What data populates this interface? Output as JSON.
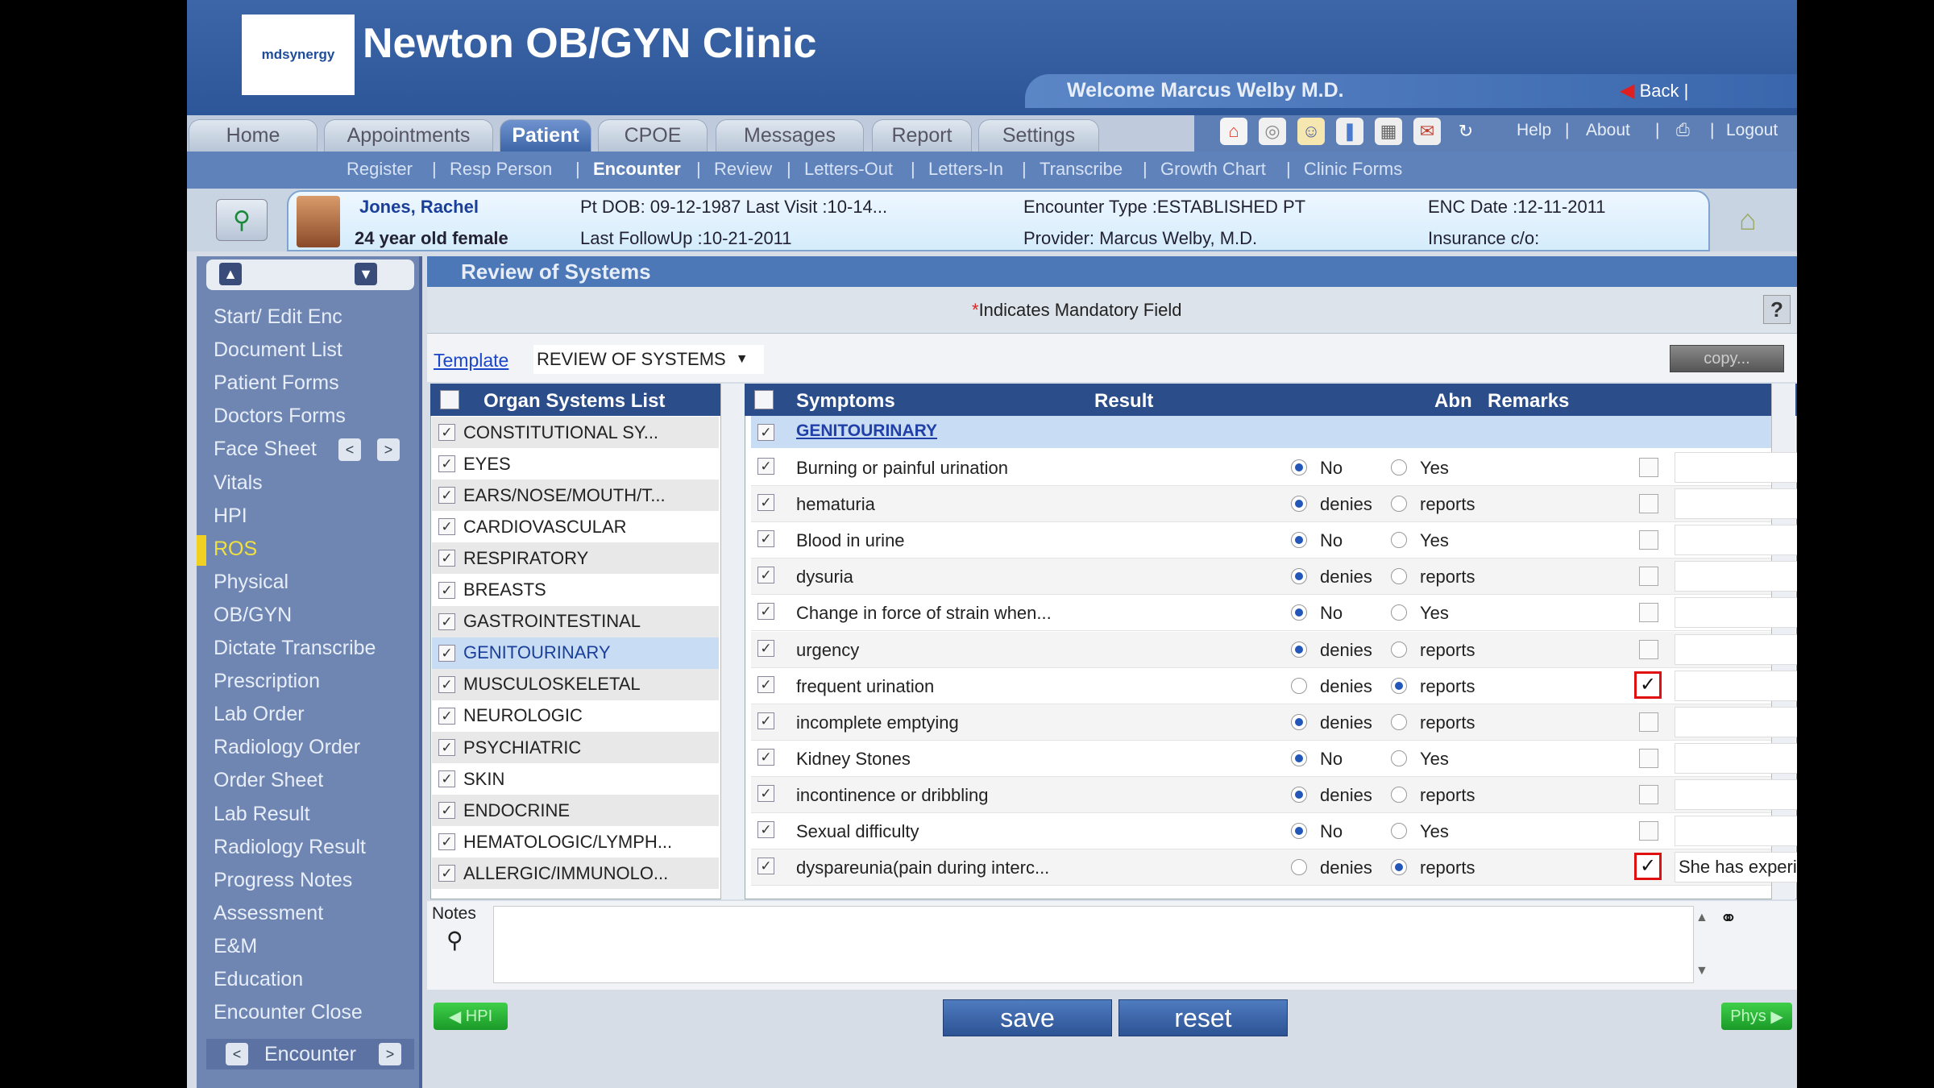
{
  "header": {
    "logo_text": "mdsynergy",
    "clinic_name": "Newton OB/GYN Clinic",
    "welcome": "Welcome Marcus Welby M.D.",
    "back_label": "Back"
  },
  "tabs": [
    "Home",
    "Appointments",
    "Patient",
    "CPOE",
    "Messages",
    "Report",
    "Settings"
  ],
  "active_tab": "Patient",
  "top_links": {
    "help": "Help",
    "about": "About",
    "logout": "Logout"
  },
  "toolbar_icons": [
    "alert-icon",
    "lab-icon",
    "user-icon",
    "vitals-icon",
    "chart-icon",
    "mail-icon",
    "refresh-icon"
  ],
  "subnav": [
    "Register",
    "Resp Person",
    "Encounter",
    "Review",
    "Letters-Out",
    "Letters-In",
    "Transcribe",
    "Growth Chart",
    "Clinic Forms"
  ],
  "patient": {
    "name": "Jones, Rachel",
    "age_sex": "24 year old female",
    "dob_last_visit": "Pt DOB: 09-12-1987 Last Visit :10-14...",
    "last_followup": "Last FollowUp :10-21-2011",
    "encounter_type": "Encounter Type :ESTABLISHED PT",
    "provider": "Provider: Marcus Welby, M.D.",
    "enc_date": "ENC Date :12-11-2011",
    "insurance": "Insurance c/o:"
  },
  "sidebar": {
    "items": [
      "Start/ Edit Enc",
      "Document List",
      "Patient Forms",
      "Doctors Forms",
      "Face Sheet",
      "Vitals",
      "HPI",
      "ROS",
      "Physical",
      "OB/GYN",
      "Dictate Transcribe",
      "Prescription",
      "Lab Order",
      "Radiology Order",
      "Order Sheet",
      "Lab Result",
      "Radiology Result",
      "Progress Notes",
      "Assessment",
      "E&M",
      "Education",
      "Encounter Close"
    ],
    "active": "ROS",
    "bottom_label": "Encounter"
  },
  "page_title": "Review of Systems",
  "mandatory_note": "Indicates Mandatory Field",
  "mandatory_mark": "*",
  "help_label": "?",
  "template": {
    "link": "Template",
    "selected": "REVIEW OF SYSTEMS",
    "copy_label": "copy..."
  },
  "organ_list": {
    "header": "Organ Systems List",
    "items": [
      "CONSTITUTIONAL SY...",
      "EYES",
      "EARS/NOSE/MOUTH/T...",
      "CARDIOVASCULAR",
      "RESPIRATORY",
      "BREASTS",
      "GASTROINTESTINAL",
      "GENITOURINARY",
      "MUSCULOSKELETAL",
      "NEUROLOGIC",
      "PSYCHIATRIC",
      "SKIN",
      "ENDOCRINE",
      "HEMATOLOGIC/LYMPH...",
      "ALLERGIC/IMMUNOLO..."
    ],
    "selected": "GENITOURINARY"
  },
  "symptoms_table": {
    "headers": {
      "symptoms": "Symptoms",
      "result": "Result",
      "abn": "Abn",
      "remarks": "Remarks"
    },
    "group": "GENITOURINARY",
    "rows": [
      {
        "symptom": "Burning or painful urination",
        "opt1": "No",
        "opt2": "Yes",
        "selected": 1,
        "abn": false,
        "remark": ""
      },
      {
        "symptom": "hematuria",
        "opt1": "denies",
        "opt2": "reports",
        "selected": 1,
        "abn": false,
        "remark": ""
      },
      {
        "symptom": "Blood in urine",
        "opt1": "No",
        "opt2": "Yes",
        "selected": 1,
        "abn": false,
        "remark": ""
      },
      {
        "symptom": "dysuria",
        "opt1": "denies",
        "opt2": "reports",
        "selected": 1,
        "abn": false,
        "remark": ""
      },
      {
        "symptom": "Change in force of strain when...",
        "opt1": "No",
        "opt2": "Yes",
        "selected": 1,
        "abn": false,
        "remark": ""
      },
      {
        "symptom": "urgency",
        "opt1": "denies",
        "opt2": "reports",
        "selected": 1,
        "abn": false,
        "remark": ""
      },
      {
        "symptom": "frequent urination",
        "opt1": "denies",
        "opt2": "reports",
        "selected": 2,
        "abn": true,
        "remark": ""
      },
      {
        "symptom": "incomplete emptying",
        "opt1": "denies",
        "opt2": "reports",
        "selected": 1,
        "abn": false,
        "remark": ""
      },
      {
        "symptom": "Kidney Stones",
        "opt1": "No",
        "opt2": "Yes",
        "selected": 1,
        "abn": false,
        "remark": ""
      },
      {
        "symptom": "incontinence or dribbling",
        "opt1": "denies",
        "opt2": "reports",
        "selected": 1,
        "abn": false,
        "remark": ""
      },
      {
        "symptom": "Sexual difficulty",
        "opt1": "No",
        "opt2": "Yes",
        "selected": 1,
        "abn": false,
        "remark": ""
      },
      {
        "symptom": "dyspareunia(pain during interc...",
        "opt1": "denies",
        "opt2": "reports",
        "selected": 2,
        "abn": true,
        "remark": "She has experienced since"
      }
    ]
  },
  "notes": {
    "label": "Notes",
    "value": ""
  },
  "buttons": {
    "save": "save",
    "reset": "reset",
    "prev": "HPI",
    "next": "Phys"
  }
}
